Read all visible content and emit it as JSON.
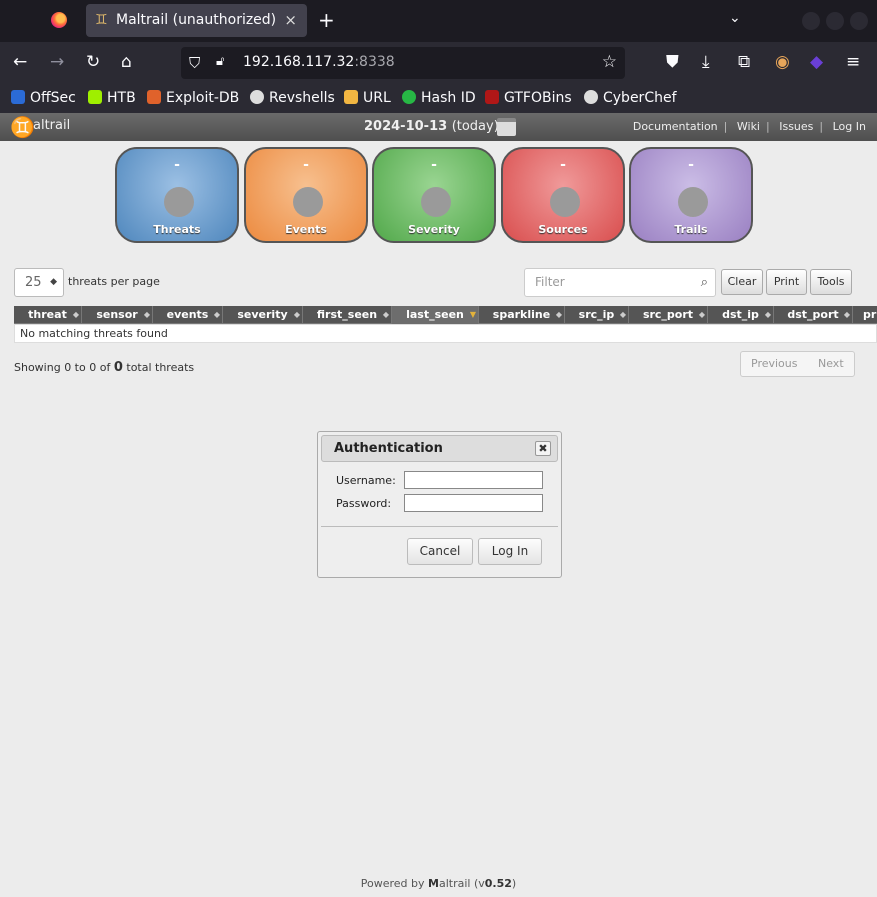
{
  "browser": {
    "tab_title": "Maltrail (unauthorized)",
    "tab_close": "×",
    "new_tab": "+",
    "url_host": "192.168.117.32",
    "url_port": ":8338"
  },
  "bookmarks": [
    {
      "label": "OffSec",
      "color": "#2b6bd6"
    },
    {
      "label": "HTB",
      "color": "#9fef00"
    },
    {
      "label": "Exploit-DB",
      "color": "#e0622b"
    },
    {
      "label": "Revshells",
      "color": "#dddddd"
    },
    {
      "label": "URL",
      "color": "#f2b642"
    },
    {
      "label": "Hash ID",
      "color": "#27b845"
    },
    {
      "label": "GTFOBins",
      "color": "#b01717"
    },
    {
      "label": "CyberChef",
      "color": "#dddddd"
    }
  ],
  "app": {
    "name": "altrail",
    "date": "2024-10-13",
    "date_suffix": "(today)",
    "links": [
      "Documentation",
      "Wiki",
      "Issues",
      "Log In"
    ]
  },
  "stats": [
    {
      "label": "Threats",
      "value": "-",
      "color": "#4f87bd"
    },
    {
      "label": "Events",
      "value": "-",
      "color": "#ec8a3f"
    },
    {
      "label": "Severity",
      "value": "-",
      "color": "#51a84a"
    },
    {
      "label": "Sources",
      "value": "-",
      "color": "#d94e4e"
    },
    {
      "label": "Trails",
      "value": "-",
      "color": "#9a80c2"
    }
  ],
  "controls": {
    "page_size": "25",
    "per_page_label": "threats per page",
    "filter_placeholder": "Filter",
    "clear": "Clear",
    "print": "Print",
    "tools": "Tools"
  },
  "table": {
    "columns": [
      "threat",
      "sensor",
      "events",
      "severity",
      "first_seen",
      "last_seen",
      "sparkline",
      "src_ip",
      "src_port",
      "dst_ip",
      "dst_port",
      "pr"
    ],
    "empty": "No matching threats found"
  },
  "info": {
    "prefix": "Showing 0 to 0 of",
    "count": "0",
    "suffix": "total threats"
  },
  "pager": {
    "previous": "Previous",
    "next": "Next"
  },
  "dialog": {
    "title": "Authentication",
    "close": "✖",
    "username_label": "Username:",
    "password_label": "Password:",
    "cancel": "Cancel",
    "login": "Log In"
  },
  "footer": {
    "prefix": "Powered by ",
    "brand_m": "M",
    "brand_rest": "altrail (v",
    "version": "0.52",
    "suffix": ")"
  }
}
